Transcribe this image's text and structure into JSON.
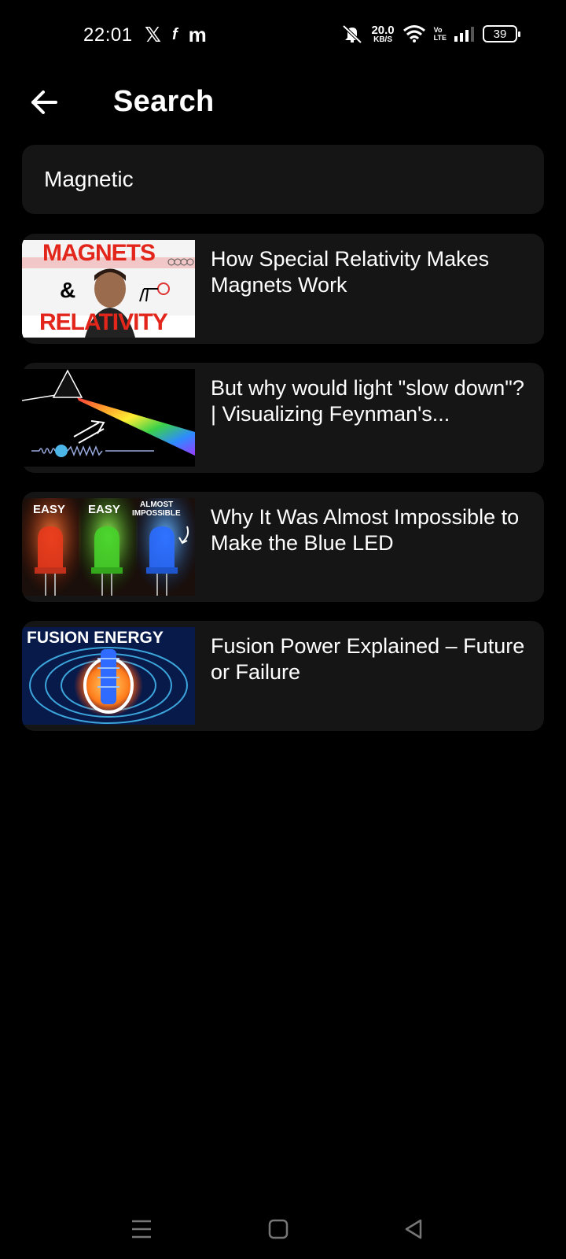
{
  "status_bar": {
    "time": "22:01",
    "left_icons": [
      "x-logo-icon",
      "facebook-icon",
      "messenger-icon"
    ],
    "speed_value": "20.0",
    "speed_unit": "KB/S",
    "volte_top": "Vo",
    "volte_bottom": "LTE",
    "battery": "39"
  },
  "header": {
    "title": "Search"
  },
  "search": {
    "value": "Magnetic"
  },
  "results": [
    {
      "title": "How Special Relativity Makes Magnets Work",
      "thumb_text_1": "MAGNETS",
      "thumb_text_2": "&",
      "thumb_text_3": "RELATIVITY"
    },
    {
      "title": "But why would light \"slow down\"? | Visualizing Feynman's..."
    },
    {
      "title": "Why It Was Almost Impossible to Make the Blue LED",
      "thumb_label_1": "EASY",
      "thumb_label_2": "EASY",
      "thumb_label_3a": "ALMOST",
      "thumb_label_3b": "IMPOSSIBLE"
    },
    {
      "title": "Fusion Power Explained – Future or Failure",
      "thumb_text": "FUSION ENERGY"
    }
  ],
  "colors": {
    "background": "#000000",
    "card": "#151515",
    "text": "#ffffff"
  }
}
